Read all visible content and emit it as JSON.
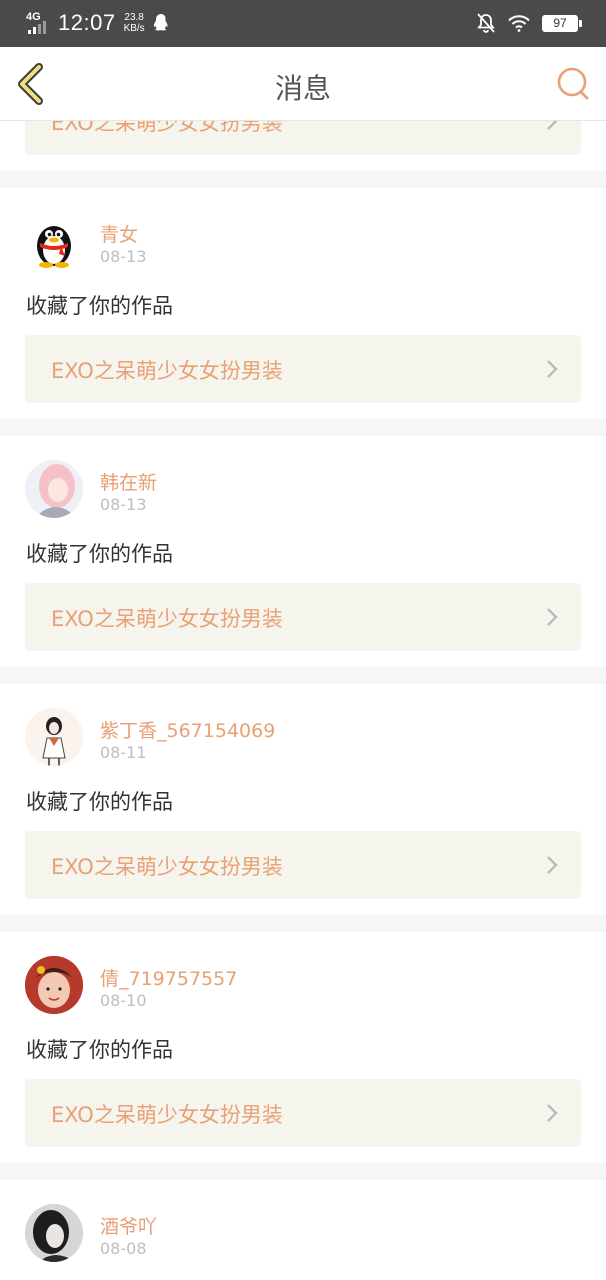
{
  "status_bar": {
    "network": "4G",
    "time": "12:07",
    "speed_value": "23.8",
    "speed_unit": "KB/s",
    "battery": "97",
    "icons": [
      "signal-icon",
      "qq-ghost-icon",
      "bell-off-icon",
      "wifi-icon",
      "battery-icon"
    ]
  },
  "header": {
    "title": "消息",
    "back_icon": "chevron-left-icon",
    "search_icon": "search-icon"
  },
  "accent": "#e8a074",
  "messages": [
    {
      "username": "",
      "date": "",
      "action": "",
      "work_title": "EXO之呆萌少女女扮男装"
    },
    {
      "username": "青女",
      "date": "08-13",
      "action": "收藏了你的作品",
      "work_title": "EXO之呆萌少女女扮男装"
    },
    {
      "username": "韩在新",
      "date": "08-13",
      "action": "收藏了你的作品",
      "work_title": "EXO之呆萌少女女扮男装"
    },
    {
      "username": "紫丁香_567154069",
      "date": "08-11",
      "action": "收藏了你的作品",
      "work_title": "EXO之呆萌少女女扮男装"
    },
    {
      "username": "倩_719757557",
      "date": "08-10",
      "action": "收藏了你的作品",
      "work_title": "EXO之呆萌少女女扮男装"
    },
    {
      "username": "酒爷吖",
      "date": "08-08",
      "action": "",
      "work_title": ""
    }
  ]
}
